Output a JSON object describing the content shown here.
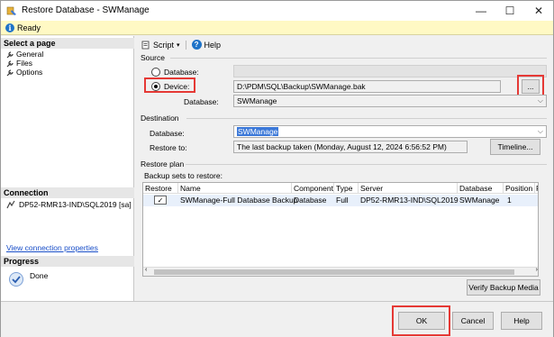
{
  "window": {
    "title": "Restore Database - SWManage",
    "minimize": "—",
    "maximize": "☐",
    "close": "✕"
  },
  "status": {
    "text": "Ready"
  },
  "left": {
    "select_page_header": "Select a page",
    "pages": [
      {
        "label": "General"
      },
      {
        "label": "Files"
      },
      {
        "label": "Options"
      }
    ],
    "connection_header": "Connection",
    "connection_text": "DP52-RMR13-IND\\SQL2019 [sa]",
    "view_properties_link": "View connection properties",
    "progress_header": "Progress",
    "progress_status": "Done"
  },
  "toolbar": {
    "script_label": "Script",
    "help_label": "Help"
  },
  "source": {
    "header": "Source",
    "database_radio_label": "Database:",
    "device_radio_label": "Device:",
    "device_path": "D:\\PDM\\SQL\\Backup\\SWManage.bak",
    "browse_label": "...",
    "database_label": "Database:",
    "database_value": "SWManage"
  },
  "destination": {
    "header": "Destination",
    "database_label": "Database:",
    "database_value": "SWManage",
    "restore_to_label": "Restore to:",
    "restore_to_value": "The last backup taken (Monday, August 12, 2024 6:56:52 PM)",
    "timeline_label": "Timeline..."
  },
  "restore_plan": {
    "header": "Restore plan",
    "backup_sets_label": "Backup sets to restore:",
    "columns": [
      "Restore",
      "Name",
      "Component",
      "Type",
      "Server",
      "Database",
      "Position",
      "F"
    ],
    "row": {
      "restore_checked": "✓",
      "name": "SWManage-Full Database Backup",
      "component": "Database",
      "type": "Full",
      "server": "DP52-RMR13-IND\\SQL2019",
      "database": "SWManage",
      "position": "1"
    },
    "verify_label": "Verify Backup Media"
  },
  "buttons": {
    "ok": "OK",
    "cancel": "Cancel",
    "help": "Help"
  },
  "colors": {
    "highlight": "#e53935",
    "accent": "#3b78d8",
    "status_bg": "#fff9c4"
  }
}
